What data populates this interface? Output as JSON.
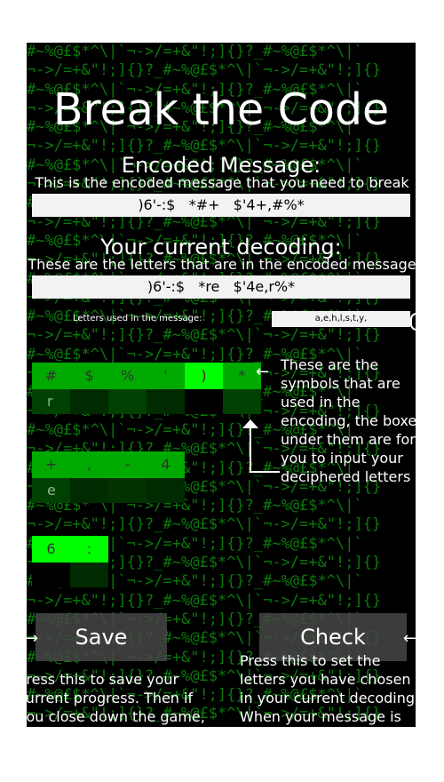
{
  "background_lines": [
    "#~%@£$*^\\|`¬->/=+&\"!;]{}?_#~%@£$*^\\|`",
    "¬->/=+&\"!;]{}?_#~%@£$*^\\|`¬->/=+&\"!;]{}",
    "#~%@£$*^\\|`¬->/=+&\"!;]{}?_#~%@£$*^\\|`",
    "¬->/=+&\"!;]{}?_#~%@£$*^\\|`¬->/=+&\"!;]{}",
    "#~%@£$*^\\|`¬->/=+&\"!;]{}?_#~%@£$*^\\|`",
    "¬->/=+&\"!;]{}?_#~%@£$*^\\|`¬->/=+&\"!;]{}",
    "#~%@£$*^\\|`¬->/=+&\"!;]{}?_#~%@£$*^\\|`",
    "¬->/=+&\"!;]{}?_#~%@£$*^\\|`¬->/=+&\"!;]{}",
    "#~%@£$*^\\|`¬->/=+&\"!;]{}?_#~%@£$*^\\|`",
    "¬->/=+&\"!;]{}?_#~%@£$*^\\|`¬->/=+&\"!;]{}",
    "#~%@£$*^\\|`¬->/=+&\"!;]{}?_#~%@£$*^\\|`",
    "¬->/=+&\"!;]{}?_#~%@£$*^\\|`¬->/=+&\"!;]{}",
    "#~%@£$*^\\|`¬->/=+&\"!;]{}?_#~%@£$*^\\|`",
    "¬->/=+&\"!;]{}?_#~%@£$*^\\|`¬->/=+&\"!;]{}",
    "#~%@£$*^\\|`¬->/=+&\"!;]{}?_#~%@£$*^\\|`",
    "¬->/=+&\"!;]{}?_#~%@£$*^\\|`¬->/=+&\"!;]{}",
    "#~%@£$*^\\|`¬->/=+&\"!;]{}?_#~%@£$*^\\|`",
    "¬->/=+&\"!;]{}?_#~%@£$*^\\|`¬->/=+&\"!;]{}",
    "#~%@£$*^\\|`¬->/=+&\"!;]{}?_#~%@£$*^\\|`",
    "¬->/=+&\"!;]{}?_#~%@£$*^\\|`¬->/=+&\"!;]{}",
    "#~%@£$*^\\|`¬->/=+&\"!;]{}?_#~%@£$*^\\|`",
    "¬->/=+&\"!;]{}?_#~%@£$*^\\|`¬->/=+&\"!;]{}",
    "#~%@£$*^\\|`¬->/=+&\"!;]{}?_#~%@£$*^\\|`",
    "¬->/=+&\"!;]{}?_#~%@£$*^\\|`¬->/=+&\"!;]{}",
    "#~%@£$*^\\|`¬->/=+&\"!;]{}?_#~%@£$*^\\|`",
    "¬->/=+&\"!;]{}?_#~%@£$*^\\|`¬->/=+&\"!;]{}",
    "#~%@£$*^\\|`¬->/=+&\"!;]{}?_#~%@£$*^\\|`",
    "¬->/=+&\"!;]{}?_#~%@£$*^\\|`¬->/=+&\"!;]{}",
    "#~%@£$*^\\|`¬->/=+&\"!;]{}?_#~%@£$*^\\|`",
    "¬->/=+&\"!;]{}?_#~%@£$*^\\|`¬->/=+&\"!;]{}",
    "#~%@£$*^\\|`¬->/=+&\"!;]{}?_#~%@£$*^\\|`",
    "¬->/=+&\"!;]{}?_#~%@£$*^\\|`¬->/=+&\"!;]{}",
    "#~%@£$*^\\|`¬->/=+&\"!;]{}?_#~%@£$*^\\|`",
    "¬->/=+&\"!;]{}?_#~%@£$*^\\|`¬->/=+&\"!;]{}",
    "#~%@£$*^\\|`¬->/=+&\"!;]{}?_#~%@£$*^\\|`",
    "¬->/=+&\"!;]{}?_#~%@£$*^\\|`¬->/=+&\"!;]{}"
  ],
  "title": "Break the Code",
  "encoded": {
    "heading": "Encoded Message:",
    "hint": "This is the encoded message that you need to break",
    "text": ")6'-:$   *#+   $'4+,#%*"
  },
  "decoding": {
    "heading": "Your current decoding:",
    "hint": "These are the letters that are in the encoded message",
    "text": ")6'-:$   *re   $'4e,r%*"
  },
  "letters_used": {
    "label": "Letters used in the message:",
    "value": "a,e,h,l,s,t,y,"
  },
  "symbols_row1": [
    "#",
    "$",
    "%",
    "'",
    ")",
    "*"
  ],
  "inputs_row1": [
    "r",
    "",
    "",
    "",
    "",
    ""
  ],
  "symbols_row2": [
    "+",
    ",",
    "-",
    "4"
  ],
  "inputs_row2": [
    "e",
    "",
    "",
    ""
  ],
  "symbols_row3": [
    "6",
    ":"
  ],
  "inputs_row3": [
    "",
    ""
  ],
  "symbols_hint": [
    "These are the",
    "symbols that are",
    "used in the",
    "encoding, the boxes",
    "under them are for",
    "you to input your",
    "deciphered letters"
  ],
  "buttons": {
    "save": "Save",
    "check": "Check"
  },
  "save_hint": [
    "Press this to save your",
    "current progress. Then if",
    "you close down the game,"
  ],
  "check_hint": [
    "Press this to set the",
    "letters you have chosen",
    "in your current decoding.",
    "When your message is"
  ],
  "colors": {
    "matrix_green": "#0a7a0a",
    "cell_green": "#00dd00"
  },
  "icons": {
    "arrow_left": "←",
    "arrow_right": "→",
    "arrow_up": "↑"
  }
}
